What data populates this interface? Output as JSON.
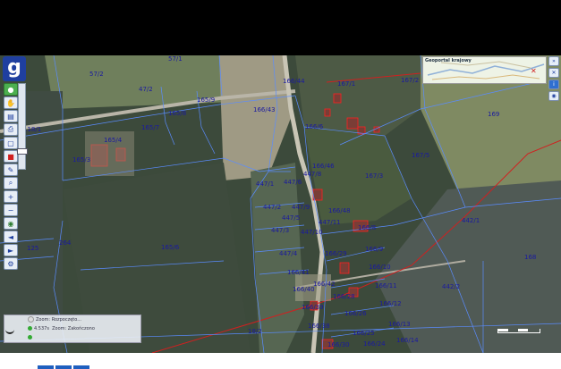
{
  "app": {
    "logo_letter": "g"
  },
  "overview_map": {
    "title": "Geoportal krajowy"
  },
  "toolbar": {
    "icons": [
      "green-dot-icon",
      "hand-icon",
      "layers-icon",
      "print-icon",
      "zoom-box-icon",
      "marker-icon",
      "ruler-icon",
      "search-icon",
      "zoom-in-icon",
      "zoom-out-icon",
      "globe-icon",
      "back-icon",
      "forward-icon",
      "settings-icon"
    ]
  },
  "zoom_level": 0.82,
  "status": {
    "line1": "Zoom: Rozpoczęto...",
    "line2_label": "4.537s",
    "line2_text": "Zoom: Zakończono",
    "line3": ""
  },
  "parcels": [
    {
      "label": "57/2"
    },
    {
      "label": "57/1"
    },
    {
      "label": "47/2"
    },
    {
      "label": "165/9"
    },
    {
      "label": "165/8"
    },
    {
      "label": "166/44"
    },
    {
      "label": "166/43"
    },
    {
      "label": "167/1"
    },
    {
      "label": "167/2"
    },
    {
      "label": "169"
    },
    {
      "label": "118/1"
    },
    {
      "label": "165/7"
    },
    {
      "label": "165/4"
    },
    {
      "label": "166/6"
    },
    {
      "label": "165/3"
    },
    {
      "label": "166/46"
    },
    {
      "label": "447/6"
    },
    {
      "label": "447/1"
    },
    {
      "label": "167/5"
    },
    {
      "label": "167/3"
    },
    {
      "label": "447/2"
    },
    {
      "label": "447/9"
    },
    {
      "label": "447/5"
    },
    {
      "label": "166/48"
    },
    {
      "label": "447/3"
    },
    {
      "label": "447/10"
    },
    {
      "label": "447/11"
    },
    {
      "label": "166/8"
    },
    {
      "label": "442/1"
    },
    {
      "label": "125"
    },
    {
      "label": "264"
    },
    {
      "label": "165/6"
    },
    {
      "label": "166/29"
    },
    {
      "label": "166/9"
    },
    {
      "label": "447/4"
    },
    {
      "label": "168"
    },
    {
      "label": "166/10"
    },
    {
      "label": "166/41"
    },
    {
      "label": "166/42"
    },
    {
      "label": "166/11"
    },
    {
      "label": "442/2"
    },
    {
      "label": "166/40"
    },
    {
      "label": "166/39"
    },
    {
      "label": "166/12"
    },
    {
      "label": "166/26"
    },
    {
      "label": "166/38"
    },
    {
      "label": "166/13"
    },
    {
      "label": "166/25"
    },
    {
      "label": "166/14"
    },
    {
      "label": "166/24"
    },
    {
      "label": "18/2"
    },
    {
      "label": "447/8"
    },
    {
      "label": "166/28"
    },
    {
      "label": "166/30"
    }
  ]
}
